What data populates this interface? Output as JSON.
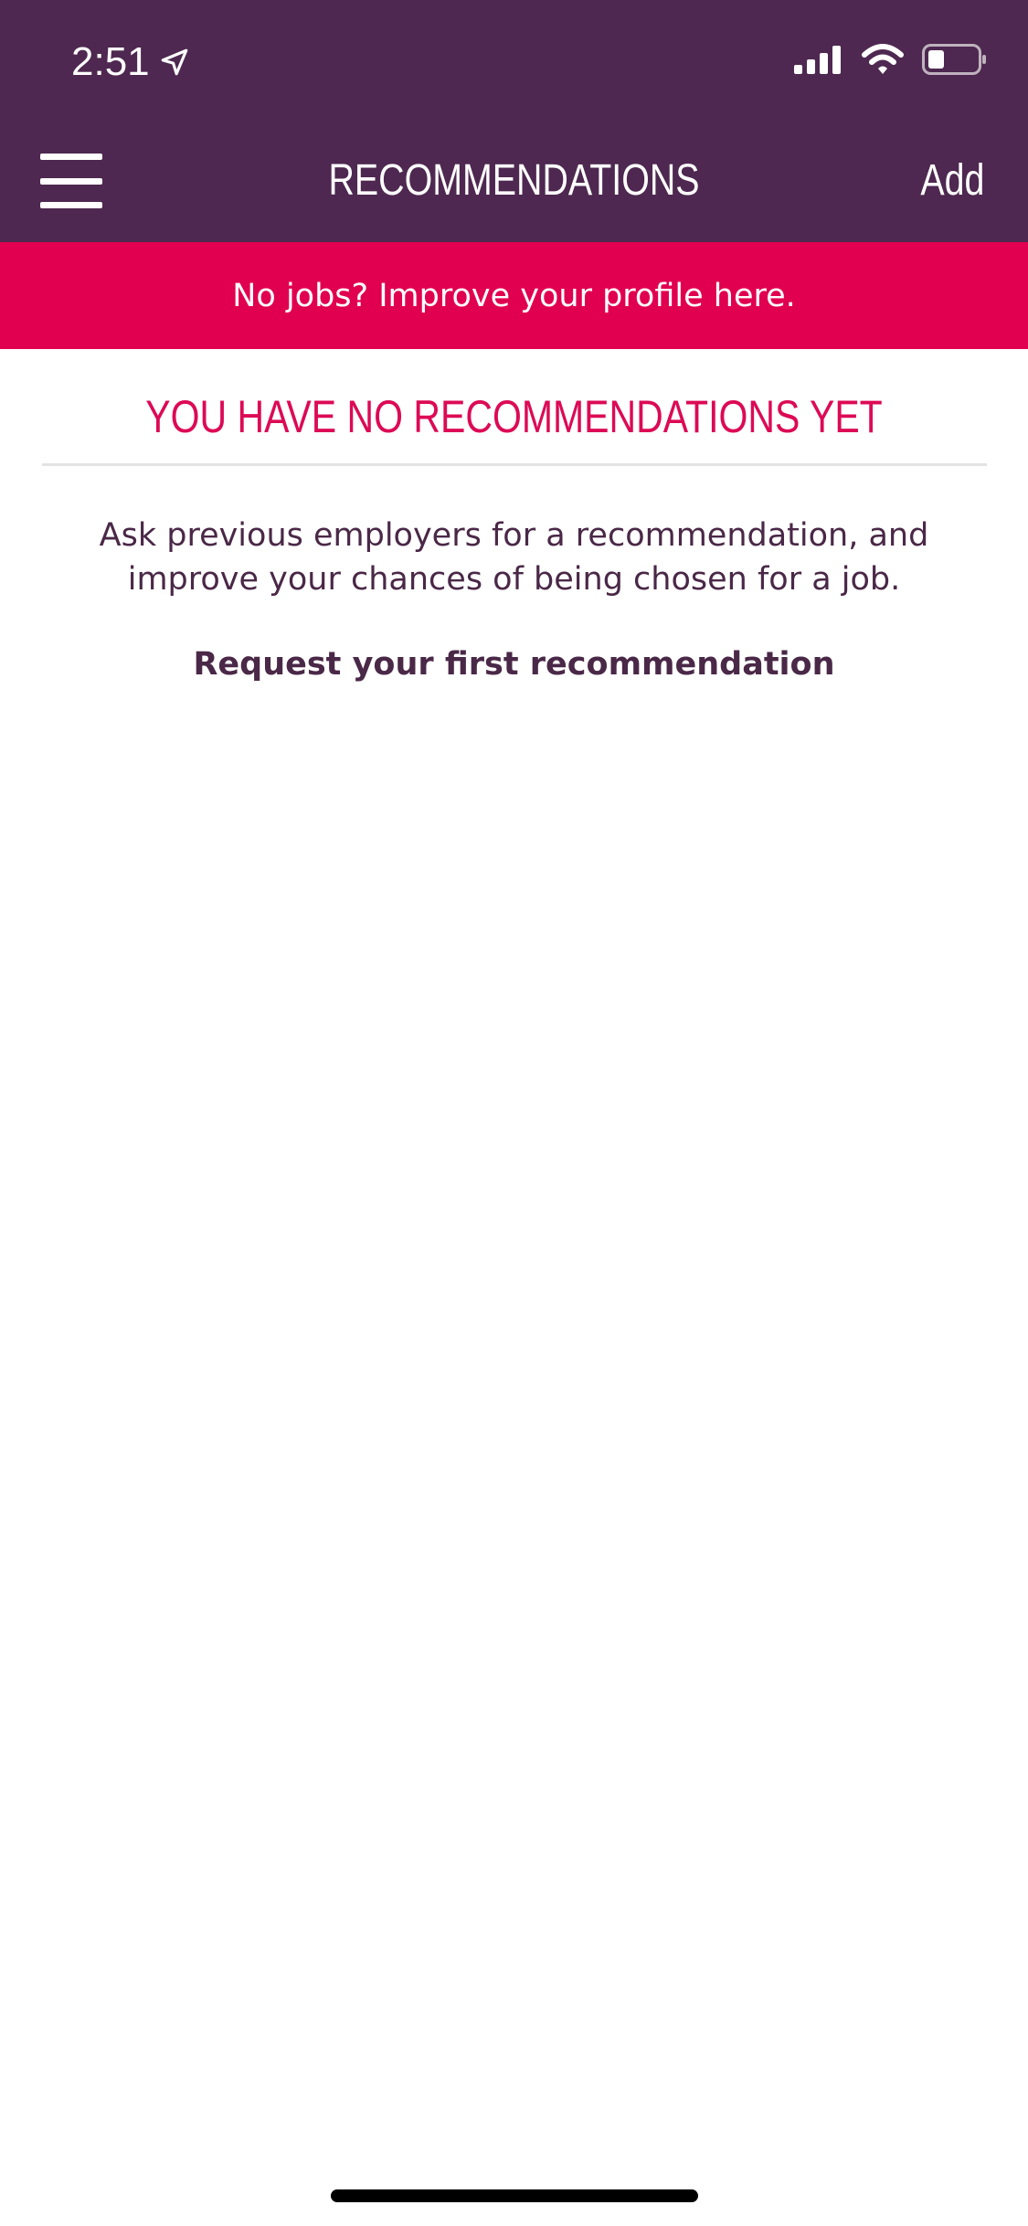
{
  "status_bar": {
    "time": "2:51",
    "icons": [
      "location-arrow-icon",
      "cellular-signal-icon",
      "wifi-icon",
      "battery-icon"
    ]
  },
  "nav": {
    "menu_icon": "hamburger-menu-icon",
    "title": "RECOMMENDATIONS",
    "add_label": "Add"
  },
  "banner": {
    "text": "No jobs? Improve your profile here."
  },
  "empty_state": {
    "title": "YOU HAVE NO RECOMMENDATIONS YET",
    "description": "Ask previous employers for a recommendation, and improve your chances of being chosen for a job.",
    "action_label": "Request your first recommendation"
  },
  "colors": {
    "header_bg": "#4e2850",
    "banner_bg": "#e1004f",
    "accent": "#dc0a55",
    "body_text": "#4a2847"
  }
}
